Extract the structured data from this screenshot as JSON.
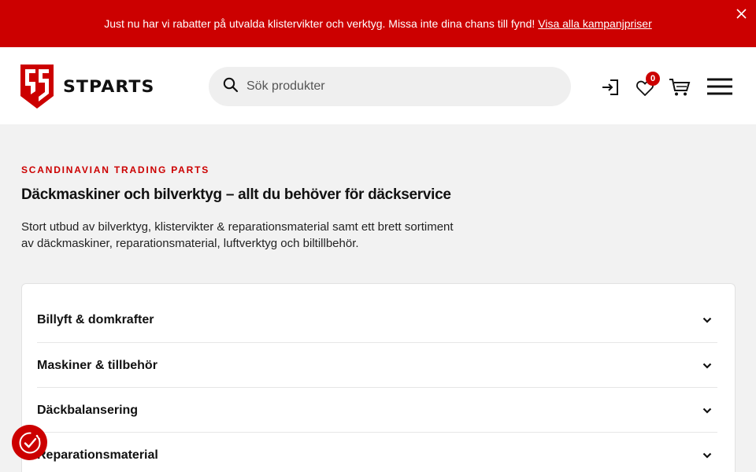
{
  "promo": {
    "text": "Just nu har vi rabatter på utvalda klistervikter och verktyg. Missa inte dina chans till fynd!",
    "link": "Visa alla kampanjpriser",
    "close_icon": "close-icon"
  },
  "header": {
    "logo_text": "STPARTS",
    "search_placeholder": "Sök produkter",
    "icons": [
      "search-icon",
      "login-icon",
      "heart-icon",
      "cart-icon",
      "menu-icon"
    ],
    "wishlist_count": "0"
  },
  "hero": {
    "eyebrow": "SCANDINAVIAN TRADING PARTS",
    "headline": "Däckmaskiner och bilverktyg – allt du behöver för däckservice",
    "description": "Stort utbud av bilverktyg, klistervikter & reparationsmaterial samt ett brett sortiment av däckmaskiner, reparationsmaterial, luftverktyg och biltillbehör."
  },
  "categories": [
    {
      "label": "Billyft & domkrafter"
    },
    {
      "label": "Maskiner & tillbehör"
    },
    {
      "label": "Däckbalansering"
    },
    {
      "label": "Reparationsmaterial"
    }
  ],
  "colors": {
    "brand_red": "#cc0000",
    "page_bg": "#f2f2f2"
  }
}
